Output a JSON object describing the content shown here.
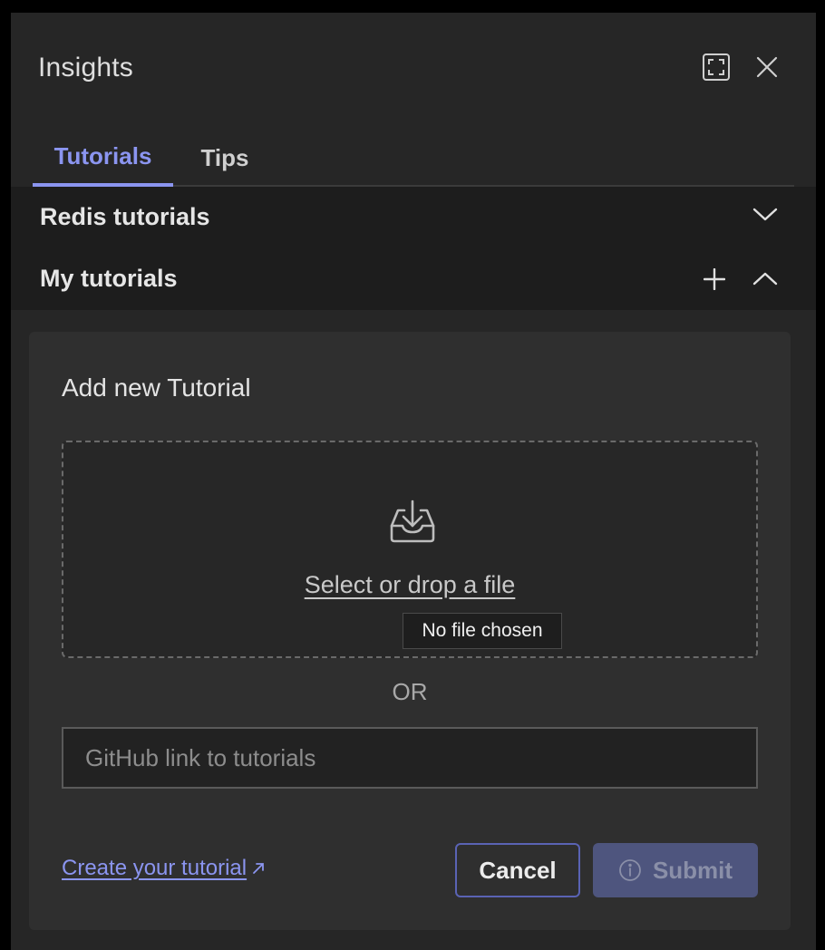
{
  "header": {
    "title": "Insights",
    "expand_icon": "fullscreen-icon",
    "close_icon": "close-icon"
  },
  "tabs": [
    {
      "label": "Tutorials",
      "active": true
    },
    {
      "label": "Tips",
      "active": false
    }
  ],
  "sections": [
    {
      "label": "Redis tutorials",
      "state": "collapsed",
      "icon": "chevron-down-icon"
    },
    {
      "label": "My tutorials",
      "state": "expanded",
      "icon": "chevron-up-icon",
      "action_icon": "plus-icon"
    }
  ],
  "form": {
    "title": "Add new Tutorial",
    "dropzone_text": "Select or drop a file",
    "dropzone_icon": "upload-tray-icon",
    "file_status": "No file chosen",
    "or_text": "OR",
    "github_placeholder": "GitHub link to tutorials",
    "github_value": "",
    "create_link": "Create your tutorial",
    "create_link_icon": "external-link-icon",
    "cancel_label": "Cancel",
    "submit_label": "Submit",
    "submit_icon": "info-icon",
    "submit_disabled": true
  },
  "colors": {
    "accent": "#8b95f0",
    "panel_bg": "#262626",
    "card_bg": "#2f2f2f",
    "submit_bg": "#4e557e"
  }
}
